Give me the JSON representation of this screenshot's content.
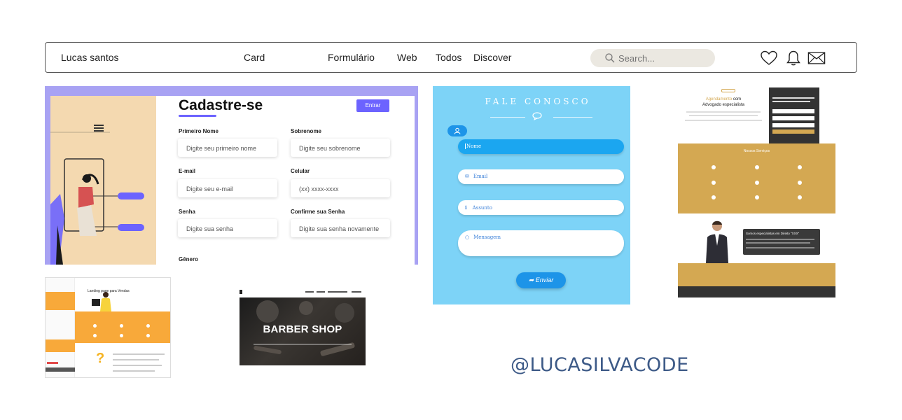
{
  "nav": {
    "brand": "Lucas santos",
    "links": [
      "Card",
      "Formulário",
      "Web",
      "Todos",
      "Discover"
    ],
    "search_placeholder": "Search..."
  },
  "signup_card": {
    "title": "Cadastre-se",
    "entrar": "Entrar",
    "fields": [
      {
        "label": "Primeiro Nome",
        "placeholder": "Digite seu primeiro nome"
      },
      {
        "label": "Sobrenome",
        "placeholder": "Digite seu sobrenome"
      },
      {
        "label": "E-mail",
        "placeholder": "Digite seu e-mail"
      },
      {
        "label": "Celular",
        "placeholder": "(xx) xxxx-xxxx"
      },
      {
        "label": "Senha",
        "placeholder": "Digite sua senha"
      },
      {
        "label": "Confirme sua Senha",
        "placeholder": "Digite sua senha novamente"
      }
    ],
    "gender_label": "Gênero"
  },
  "contact_card": {
    "title": "FALE CONOSCO",
    "fields": [
      "Nome",
      "Email",
      "Assunto",
      "Mensagem"
    ],
    "send": "Enviar"
  },
  "law_card": {
    "hero_title_accent": "Agendamento",
    "hero_title_rest": "com",
    "hero_title_line2": "Advogado especialista",
    "services_title": "Nossos Serviços",
    "specialists_title": "Somos especialistas em Direito \"XXX\""
  },
  "landing_card": {
    "title": "Landing page para Vendas"
  },
  "barber_card": {
    "title": "BARBER SHOP"
  },
  "handle": "@LUCASILVACODE",
  "colors": {
    "accent_purple": "#6c63ff",
    "contact_blue": "#7dd3f7",
    "law_gold": "#d4a852",
    "handle_blue": "#3d5a87"
  }
}
